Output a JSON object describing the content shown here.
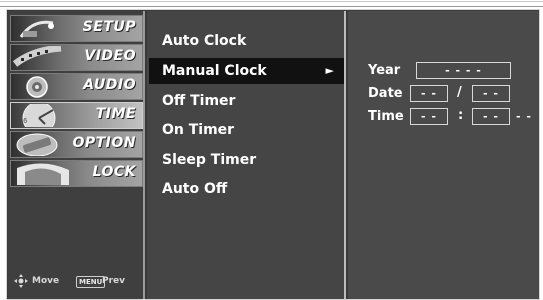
{
  "sidebar": {
    "items": [
      {
        "label": "SETUP",
        "icon": "satellite-dish-icon"
      },
      {
        "label": "VIDEO",
        "icon": "film-strip-icon"
      },
      {
        "label": "AUDIO",
        "icon": "speaker-icon"
      },
      {
        "label": "TIME",
        "icon": "clock-icon"
      },
      {
        "label": "OPTION",
        "icon": "option-badge-icon"
      },
      {
        "label": "LOCK",
        "icon": "lock-icon"
      }
    ],
    "active_index": 3,
    "footer": {
      "move_label": "Move",
      "menu_key_label": "MENU",
      "prev_label": "Prev"
    }
  },
  "menu": {
    "items": [
      {
        "label": "Auto Clock"
      },
      {
        "label": "Manual Clock"
      },
      {
        "label": "Off Timer"
      },
      {
        "label": "On Timer"
      },
      {
        "label": "Sleep Timer"
      },
      {
        "label": "Auto Off"
      }
    ],
    "selected_index": 1,
    "arrow": "►"
  },
  "clock": {
    "year_label": "Year",
    "year_value": "- - - -",
    "date_label": "Date",
    "date_month": "- -",
    "date_separator": "/",
    "date_day": "- -",
    "time_label": "Time",
    "time_hour": "- -",
    "time_separator": ":",
    "time_minute": "- -",
    "time_ampm": "- -"
  },
  "colors": {
    "osd_background": "#3a3a3a",
    "selected_row": "#111111",
    "text": "#ffffff"
  }
}
